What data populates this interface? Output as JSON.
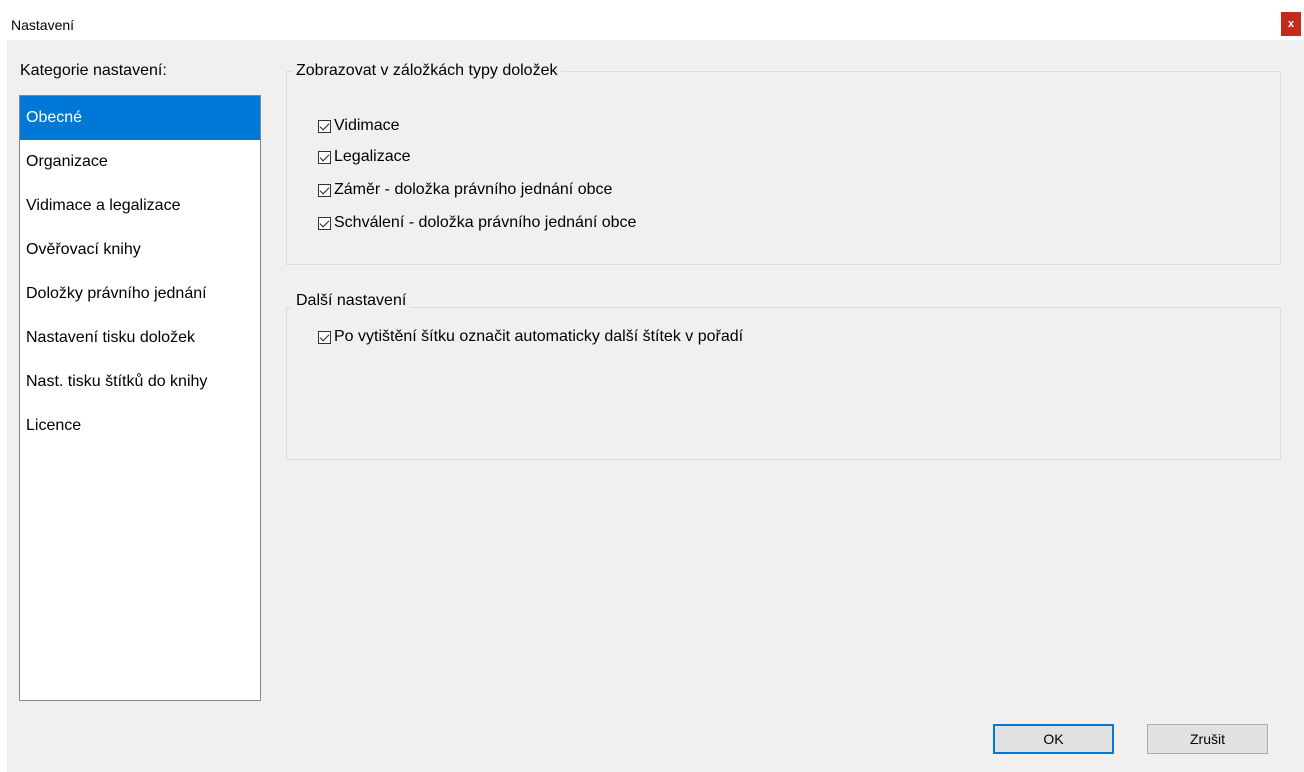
{
  "window": {
    "title": "Nastavení",
    "close_label": "x"
  },
  "categories": {
    "label": "Kategorie nastavení:",
    "items": [
      "Obecné",
      "Organizace",
      "Vidimace a legalizace",
      "Ověřovací knihy",
      "Doložky právního jednání",
      "Nastavení tisku doložek",
      "Nast. tisku štítků do knihy",
      "Licence"
    ],
    "selected": "Obecné"
  },
  "group1": {
    "title": "Zobrazovat v záložkách typy doložek",
    "checkboxes": [
      {
        "label": "Vidimace",
        "checked": true
      },
      {
        "label": "Legalizace",
        "checked": true
      },
      {
        "label": "Záměr - doložka právního jednání obce",
        "checked": true
      },
      {
        "label": "Schválení - doložka právního jednání obce",
        "checked": true
      }
    ]
  },
  "group2": {
    "title": "Další nastavení",
    "checkboxes": [
      {
        "label": "Po vytištění šítku označit automaticky další štítek v pořadí",
        "checked": true
      }
    ]
  },
  "buttons": {
    "ok": "OK",
    "cancel": "Zrušit"
  },
  "colors": {
    "selection": "#0078d7",
    "close": "#c42b1c"
  }
}
